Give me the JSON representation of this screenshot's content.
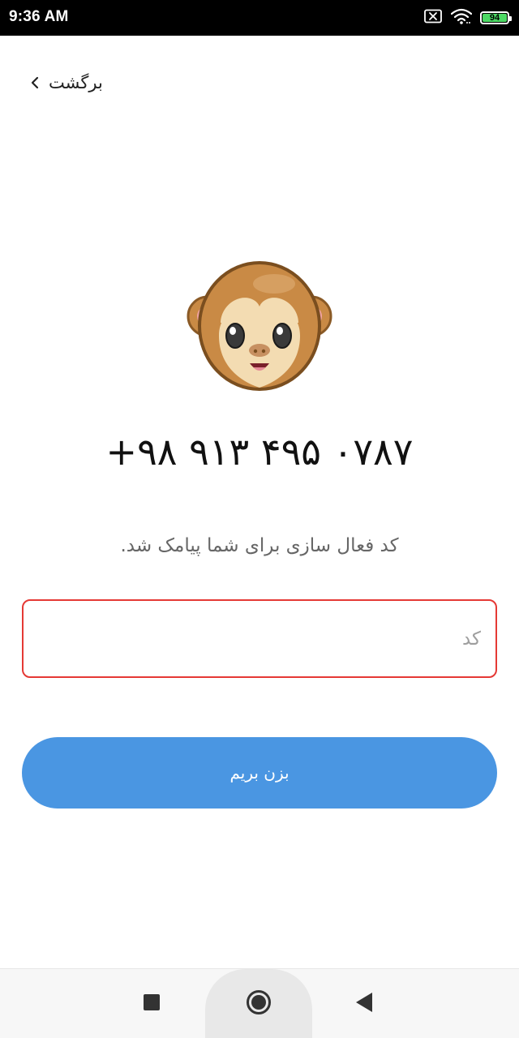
{
  "status_bar": {
    "time": "9:36 AM",
    "battery_level": "94",
    "icons": [
      "sim-off-icon",
      "wifi-icon",
      "battery-icon"
    ]
  },
  "header": {
    "back_label": "برگشت"
  },
  "main": {
    "phone_number": "+۹۸ ۹۱۳ ۴۹۵ ۰۷۸۷",
    "sms_note": "کد فعال سازی برای شما پیامک شد.",
    "code_input": {
      "value": "",
      "placeholder": "کد"
    },
    "submit_label": "بزن بریم"
  },
  "colors": {
    "accent": "#4a96e2",
    "input_border_error": "#e53935",
    "battery": "#4cd964"
  },
  "nav_bar": {
    "buttons": [
      "recents-icon",
      "home-icon",
      "back-icon"
    ]
  }
}
